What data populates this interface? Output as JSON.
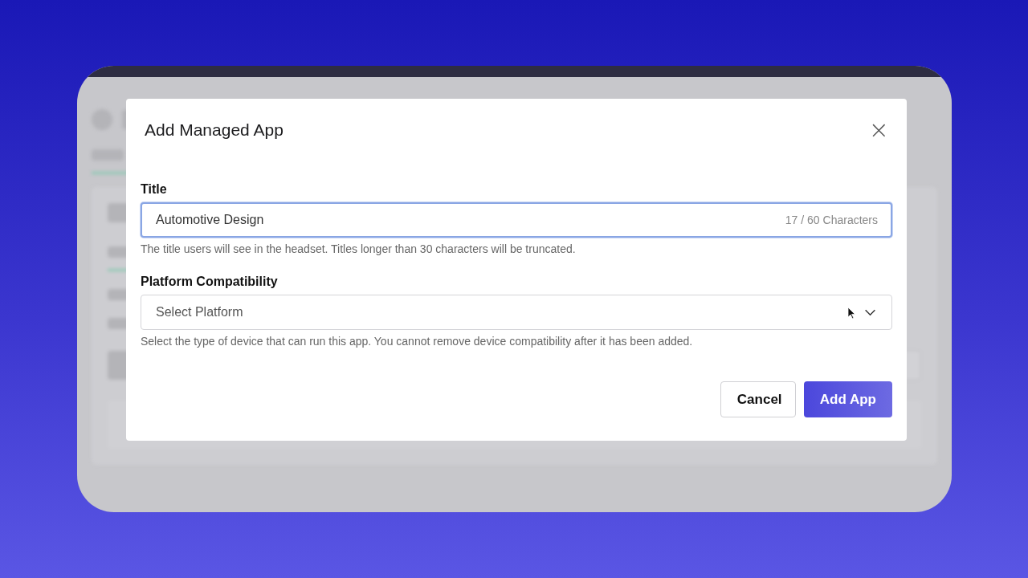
{
  "dialog": {
    "title": "Add Managed App",
    "close": "×"
  },
  "fields": [
    {
      "kind": "text",
      "label": "Title",
      "value": "Automotive Design",
      "counter": "17 / 60 Characters",
      "help": "The title users will see in the headset. Titles longer than 30 characters will be truncated.",
      "focused": true
    },
    {
      "kind": "select",
      "label": "Platform Compatibility",
      "placeholder": "Select Platform",
      "help": "Select the type of device that can run this app. You cannot remove device compatibility after it has been added.",
      "focused": false
    }
  ],
  "buttons": [
    {
      "kind": "secondary",
      "label": "Cancel"
    },
    {
      "kind": "primary",
      "label": "Add App"
    }
  ]
}
